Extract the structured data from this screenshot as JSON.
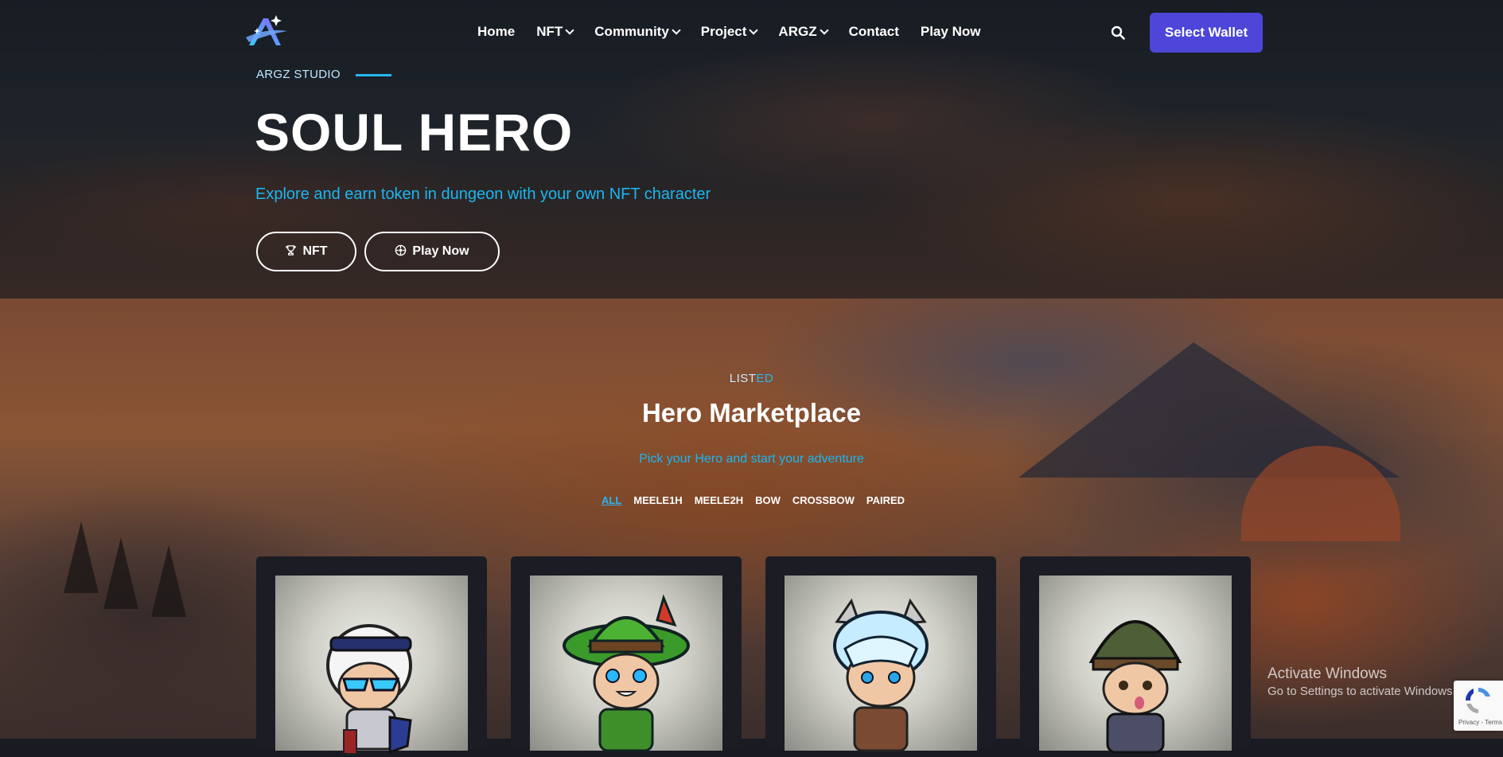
{
  "nav": {
    "items": [
      {
        "label": "Home",
        "dropdown": false
      },
      {
        "label": "NFT",
        "dropdown": true
      },
      {
        "label": "Community",
        "dropdown": true
      },
      {
        "label": "Project",
        "dropdown": true
      },
      {
        "label": "ARGZ",
        "dropdown": true
      },
      {
        "label": "Contact",
        "dropdown": false
      },
      {
        "label": "Play Now",
        "dropdown": false
      }
    ],
    "wallet_label": "Select Wallet"
  },
  "hero": {
    "eyebrow": "ARGZ STUDIO",
    "title": "SOUL HERO",
    "subtitle": "Explore and earn token in dungeon with your own NFT character",
    "btn_nft": "NFT",
    "btn_play": "Play Now"
  },
  "market": {
    "eyebrow_a": "LIST",
    "eyebrow_b": "ED",
    "title": "Hero Marketplace",
    "subtitle": "Pick your Hero and start your adventure",
    "filters": [
      "ALL",
      "MEELE1H",
      "MEELE2H",
      "BOW",
      "CROSSBOW",
      "PAIRED"
    ],
    "active_filter": "ALL"
  },
  "os_overlay": {
    "activate_title": "Activate Windows",
    "activate_sub": "Go to Settings to activate Windows.",
    "recaptcha_label": "Privacy - Terms"
  },
  "colors": {
    "accent": "#27b6f0",
    "wallet": "#4d46d8",
    "card_bg": "#1c1c24"
  }
}
